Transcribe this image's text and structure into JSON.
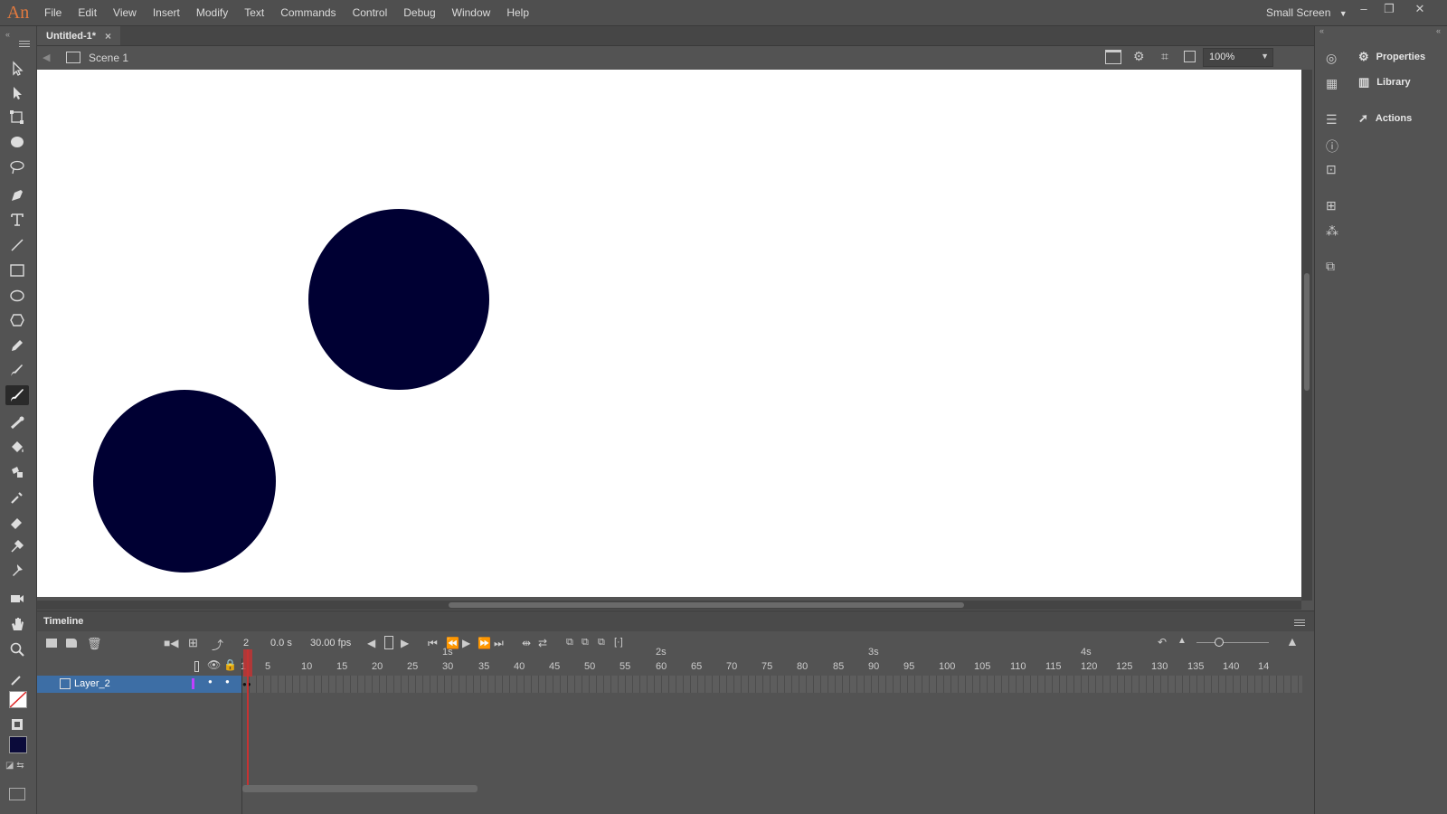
{
  "app": {
    "logo_text": "An"
  },
  "menu": [
    "File",
    "Edit",
    "View",
    "Insert",
    "Modify",
    "Text",
    "Commands",
    "Control",
    "Debug",
    "Window",
    "Help"
  ],
  "workspace": {
    "label": "Small Screen"
  },
  "window_controls": {
    "minimize": "–",
    "restore": "❐",
    "close": "✕"
  },
  "document": {
    "tab_title": "Untitled-1*",
    "close_glyph": "×",
    "scene_label": "Scene 1",
    "zoom_value": "100%"
  },
  "stage": {
    "background": "#ffffff",
    "shape_color": "#000033"
  },
  "timeline": {
    "title": "Timeline",
    "current_frame": "2",
    "elapsed_time": "0.0 s",
    "frame_rate": "30.00 fps",
    "second_markers": [
      "1s",
      "2s",
      "3s",
      "4s"
    ],
    "frame_numbers": [
      "1",
      "5",
      "10",
      "15",
      "20",
      "25",
      "30",
      "35",
      "40",
      "45",
      "50",
      "55",
      "60",
      "65",
      "70",
      "75",
      "80",
      "85",
      "90",
      "95",
      "100",
      "105",
      "110",
      "115",
      "120",
      "125",
      "130",
      "135",
      "140",
      "14"
    ],
    "layers": [
      {
        "name": "Layer_2"
      }
    ]
  },
  "panels": {
    "properties": "Properties",
    "library": "Library",
    "actions": "Actions"
  },
  "colors": {
    "accent_layer": "#3d6ea5",
    "playhead": "#c83232",
    "fill_swatch": "#0b0b3a"
  }
}
